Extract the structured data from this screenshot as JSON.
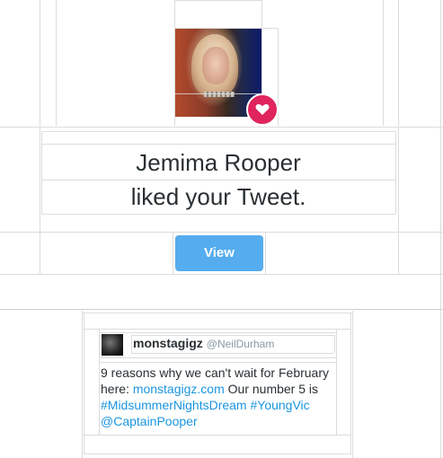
{
  "notification": {
    "actor_name": "Jemima Rooper",
    "action_text": "liked your Tweet.",
    "view_label": "View",
    "avatar_icon": "profile-photo",
    "badge_icon": "heart-icon",
    "badge_color": "#e0245e",
    "button_color": "#55acee"
  },
  "tweet": {
    "display_name": "monstagigz",
    "handle": "@NeilDurham",
    "text_prefix": "9 reasons why we can't wait for February here: ",
    "link": "monstagigz.com",
    "text_mid": " Our number 5 is ",
    "hashtag1": "#MidsummerNightsDream",
    "hashtag2": "#YoungVic",
    "mention": "@CaptainPooper"
  }
}
